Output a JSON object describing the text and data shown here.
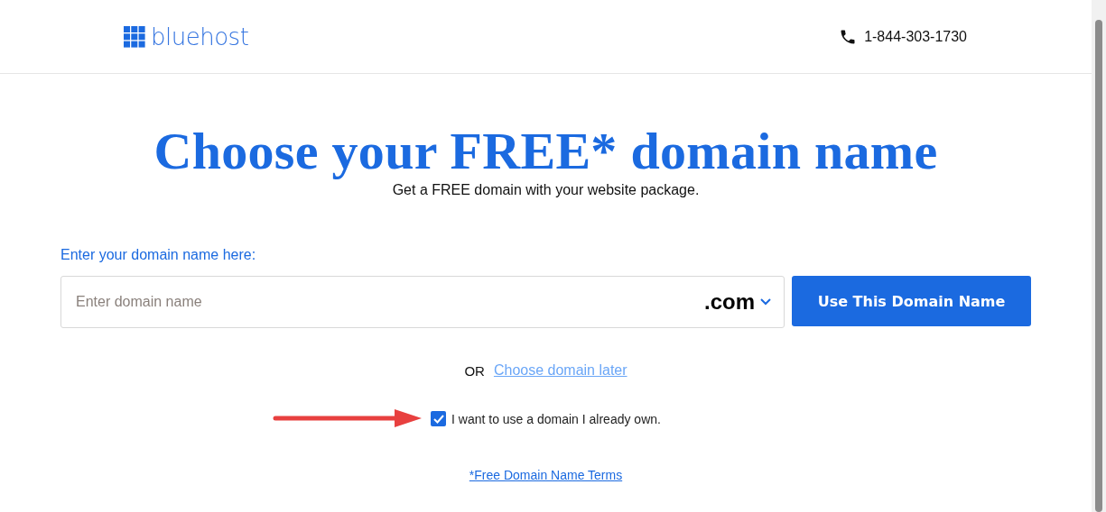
{
  "header": {
    "logo": "bluehost",
    "phone": "1-844-303-1730"
  },
  "heading": "Choose your FREE* domain name",
  "subheading": "Get a FREE domain with your website package.",
  "domain_form": {
    "label": "Enter your domain name here:",
    "placeholder": "Enter domain name",
    "tld": ".com",
    "button": "Use This Domain Name"
  },
  "or_text": "OR",
  "later_link": "Choose domain later",
  "own_domain": {
    "label": "I want to use a domain I already own.",
    "checked": true
  },
  "terms_link": "*Free Domain Name Terms"
}
